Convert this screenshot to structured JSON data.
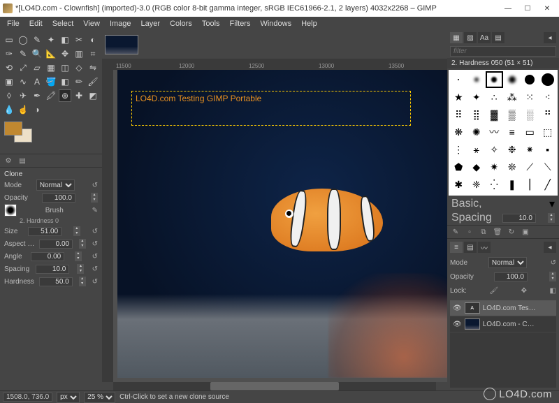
{
  "window": {
    "title": "*[LO4D.com - Clownfish] (imported)-3.0 (RGB color 8-bit gamma integer, sRGB IEC61966-2.1, 2 layers) 4032x2268 – GIMP",
    "min": "—",
    "max": "☐",
    "close": "✕"
  },
  "menu": [
    "File",
    "Edit",
    "Select",
    "View",
    "Image",
    "Layer",
    "Colors",
    "Tools",
    "Filters",
    "Windows",
    "Help"
  ],
  "ruler": {
    "marks": [
      "11500",
      "12000",
      "12500",
      "13000",
      "13500"
    ]
  },
  "canvas": {
    "selection_text": "LO4D.com Testing GIMP Portable"
  },
  "clone": {
    "title": "Clone",
    "mode_label": "Mode",
    "mode_value": "Normal",
    "opacity_label": "Opacity",
    "opacity_value": "100.0",
    "brush_label": "Brush",
    "brush_name": "2. Hardness 0",
    "size_label": "Size",
    "size_value": "51.00",
    "aspect_label": "Aspect …",
    "aspect_value": "0.00",
    "angle_label": "Angle",
    "angle_value": "0.00",
    "spacing_label": "Spacing",
    "spacing_value": "10.0",
    "hardness_label": "Hardness",
    "hardness_value": "50.0"
  },
  "right": {
    "filter_placeholder": "filter",
    "brush_selected": "2. Hardness 050 (51 × 51)",
    "basic_label": "Basic,",
    "spacing_label": "Spacing",
    "spacing_value": "10.0"
  },
  "layers": {
    "mode_label": "Mode",
    "mode_value": "Normal",
    "opacity_label": "Opacity",
    "opacity_value": "100.0",
    "lock_label": "Lock:",
    "items": [
      {
        "name": "LO4D.com Tes…"
      },
      {
        "name": "LO4D.com - C…"
      }
    ]
  },
  "status": {
    "coords": "1508.0, 736.0",
    "unit": "px",
    "zoom": "25 %",
    "hint": "Ctrl-Click to set a new clone source"
  },
  "watermark": "LO4D.com"
}
